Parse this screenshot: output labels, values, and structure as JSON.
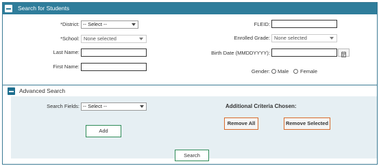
{
  "header": {
    "title": "Search for Students"
  },
  "form": {
    "district": {
      "label": "*District:",
      "value": "-- Select --"
    },
    "school": {
      "label": "*School:",
      "value": "None selected"
    },
    "last_name": {
      "label": "Last Name:",
      "value": ""
    },
    "first_name": {
      "label": "First Name:",
      "value": ""
    },
    "fleid": {
      "label": "FLEID:",
      "value": ""
    },
    "enrolled_grade": {
      "label": "Enrolled Grade:",
      "value": "None selected"
    },
    "birth_date": {
      "label": "Birth Date (MMDDYYYY):",
      "value": ""
    },
    "gender": {
      "label": "Gender:",
      "options": [
        "Male",
        "Female"
      ]
    }
  },
  "advanced": {
    "title": "Advanced Search",
    "search_fields": {
      "label": "Search Fields:",
      "value": "-- Select --"
    },
    "add_label": "Add",
    "criteria_title": "Additional Criteria Chosen:",
    "remove_all_label": "Remove All",
    "remove_selected_label": "Remove Selected"
  },
  "search_label": "Search",
  "icons": {
    "collapse": "minus-icon",
    "calendar": "calendar-icon",
    "caret": "chevron-down-icon"
  },
  "colors": {
    "header_bg": "#2f7d9b",
    "panel_bg": "#e6eff3",
    "green_border": "#2e8b57",
    "orange_border": "#d86a2a"
  }
}
